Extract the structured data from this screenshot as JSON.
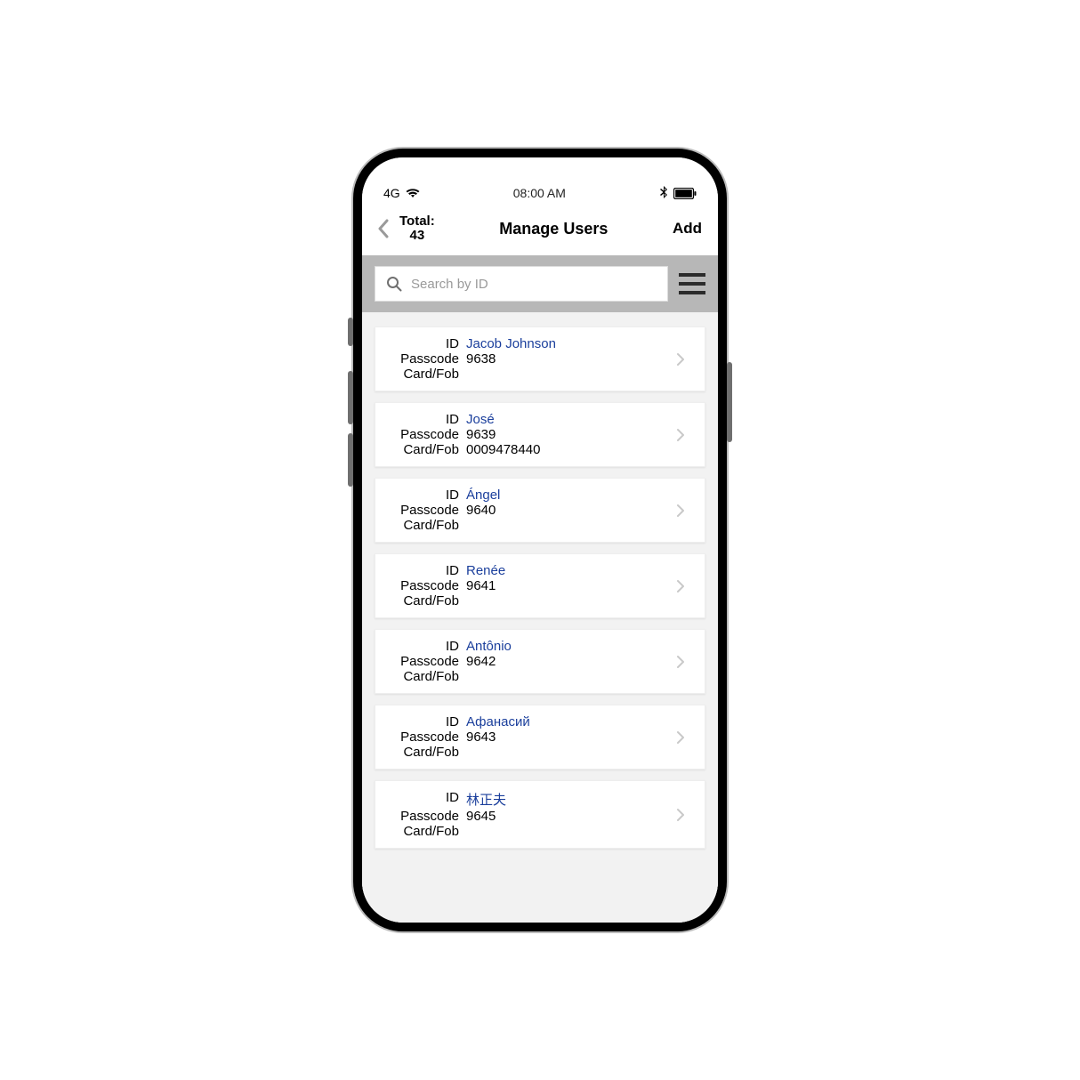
{
  "status": {
    "network": "4G",
    "time": "08:00 AM"
  },
  "header": {
    "total_label": "Total:",
    "total_count": "43",
    "title": "Manage Users",
    "add_label": "Add"
  },
  "search": {
    "placeholder": "Search by ID"
  },
  "labels": {
    "id": "ID",
    "passcode": "Passcode",
    "cardfob": "Card/Fob"
  },
  "users": [
    {
      "id": "Jacob Johnson",
      "passcode": "9638",
      "cardfob": ""
    },
    {
      "id": "José",
      "passcode": "9639",
      "cardfob": "0009478440"
    },
    {
      "id": "Ángel",
      "passcode": "9640",
      "cardfob": ""
    },
    {
      "id": "Renée",
      "passcode": "9641",
      "cardfob": ""
    },
    {
      "id": "Antônio",
      "passcode": "9642",
      "cardfob": ""
    },
    {
      "id": "Афанасий",
      "passcode": "9643",
      "cardfob": ""
    },
    {
      "id": "林正夫",
      "passcode": "9645",
      "cardfob": ""
    }
  ]
}
